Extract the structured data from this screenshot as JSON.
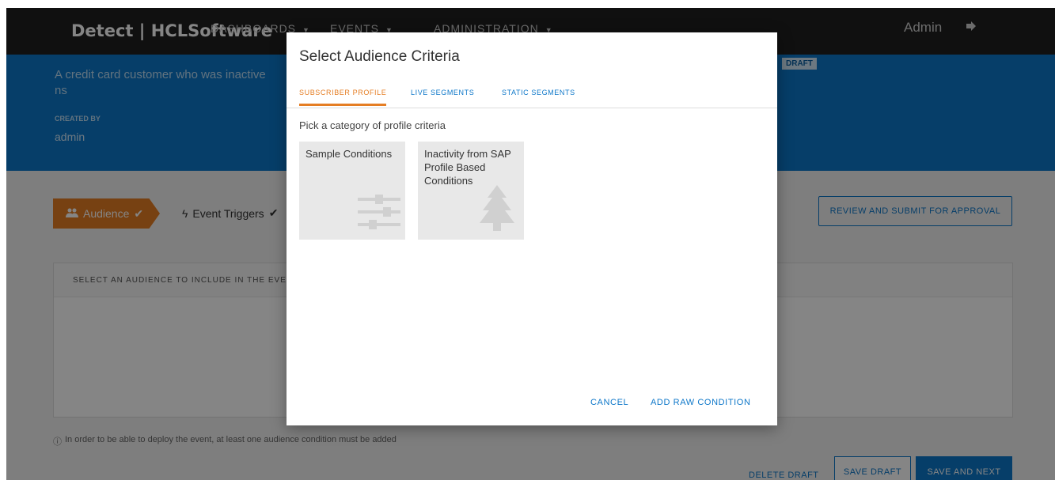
{
  "app": {
    "brand": "Detect | HCLSoftware",
    "nav": [
      {
        "label": "DASHBOARDS"
      },
      {
        "label": "EVENTS"
      },
      {
        "label": "ADMINISTRATION"
      }
    ],
    "user": "Admin"
  },
  "header": {
    "description": "A credit card customer who was inactive",
    "description_tail": "ns",
    "created_by_label": "CREATED BY",
    "created_by": "admin",
    "status_badge": "DRAFT"
  },
  "wizard": {
    "step_audience": "Audience",
    "step_triggers": "Event Triggers",
    "review_button": "REVIEW AND SUBMIT FOR APPROVAL"
  },
  "panel": {
    "heading": "SELECT AN AUDIENCE TO INCLUDE IN THE EVE"
  },
  "footer": {
    "info_note": "In order to be able to deploy the event, at least one audience condition must be added",
    "delete_draft": "DELETE DRAFT",
    "save_draft": "SAVE DRAFT",
    "save_next": "SAVE AND NEXT"
  },
  "modal": {
    "title": "Select Audience Criteria",
    "tabs": [
      {
        "label": "SUBSCRIBER PROFILE",
        "active": true
      },
      {
        "label": "LIVE SEGMENTS",
        "active": false
      },
      {
        "label": "STATIC SEGMENTS",
        "active": false
      }
    ],
    "subtitle": "Pick a category of profile criteria",
    "tiles": [
      {
        "label": "Sample Conditions",
        "icon": "sliders-icon"
      },
      {
        "label": "Inactivity from SAP Profile Based Conditions",
        "icon": "tree-icon"
      }
    ],
    "cancel": "CANCEL",
    "add_raw": "ADD RAW CONDITION"
  },
  "colors": {
    "nav_bg": "#1f1f1f",
    "header_blue": "#0d77c9",
    "accent_orange": "#e57e24"
  }
}
